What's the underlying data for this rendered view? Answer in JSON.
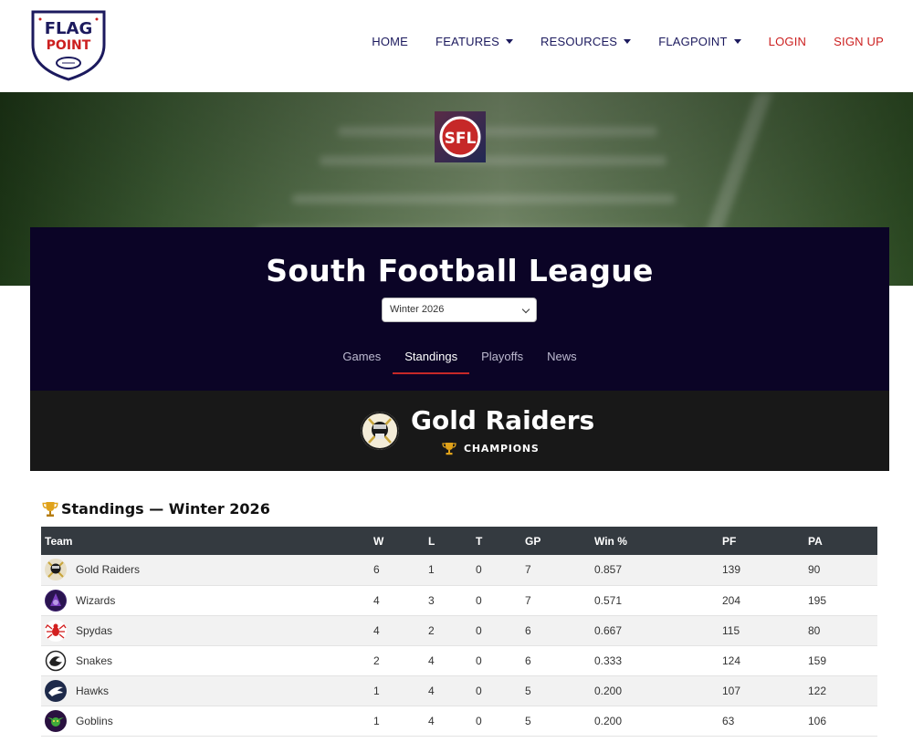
{
  "nav": {
    "logo_text": [
      "FLAG",
      "POINT"
    ],
    "items": [
      {
        "label": "HOME",
        "dropdown": false,
        "red": false
      },
      {
        "label": "FEATURES",
        "dropdown": true,
        "red": false
      },
      {
        "label": "RESOURCES",
        "dropdown": true,
        "red": false
      },
      {
        "label": "FLAGPOINT",
        "dropdown": true,
        "red": false
      },
      {
        "label": "LOGIN",
        "dropdown": false,
        "red": true
      },
      {
        "label": "SIGN UP",
        "dropdown": false,
        "red": true
      }
    ]
  },
  "league": {
    "logo_text": "SFL",
    "title": "South Football League",
    "season_selected": "Winter 2026",
    "tabs": [
      "Games",
      "Standings",
      "Playoffs",
      "News"
    ],
    "active_tab": "Standings"
  },
  "champion": {
    "team": "Gold Raiders",
    "badge": "CHAMPIONS"
  },
  "standings": {
    "title": "Standings — Winter 2026",
    "columns": [
      "Team",
      "W",
      "L",
      "T",
      "GP",
      "Win %",
      "PF",
      "PA"
    ],
    "rows": [
      {
        "team": "Gold Raiders",
        "icon": "gold-raiders-logo-icon",
        "color": "#e8dfc6",
        "w": "6",
        "l": "1",
        "t": "0",
        "gp": "7",
        "pct": "0.857",
        "pf": "139",
        "pa": "90"
      },
      {
        "team": "Wizards",
        "icon": "wizards-logo-icon",
        "color": "#3b1f6b",
        "w": "4",
        "l": "3",
        "t": "0",
        "gp": "7",
        "pct": "0.571",
        "pf": "204",
        "pa": "195"
      },
      {
        "team": "Spydas",
        "icon": "spydas-logo-icon",
        "color": "#ffffff",
        "w": "4",
        "l": "2",
        "t": "0",
        "gp": "6",
        "pct": "0.667",
        "pf": "115",
        "pa": "80"
      },
      {
        "team": "Snakes",
        "icon": "snakes-logo-icon",
        "color": "#ffffff",
        "w": "2",
        "l": "4",
        "t": "0",
        "gp": "6",
        "pct": "0.333",
        "pf": "124",
        "pa": "159"
      },
      {
        "team": "Hawks",
        "icon": "hawks-logo-icon",
        "color": "#1e2a4a",
        "w": "1",
        "l": "4",
        "t": "0",
        "gp": "5",
        "pct": "0.200",
        "pf": "107",
        "pa": "122"
      },
      {
        "team": "Goblins",
        "icon": "goblins-logo-icon",
        "color": "#2a1140",
        "w": "1",
        "l": "4",
        "t": "0",
        "gp": "5",
        "pct": "0.200",
        "pf": "63",
        "pa": "106"
      }
    ]
  },
  "colors": {
    "nav_text": "#1c1a5e",
    "nav_red": "#cc1f1f",
    "banner_bg": "#0b0426",
    "champ_bg": "#181818",
    "table_header": "#343a40",
    "tab_underline": "#c62828",
    "trophy": "#e0a21a"
  }
}
